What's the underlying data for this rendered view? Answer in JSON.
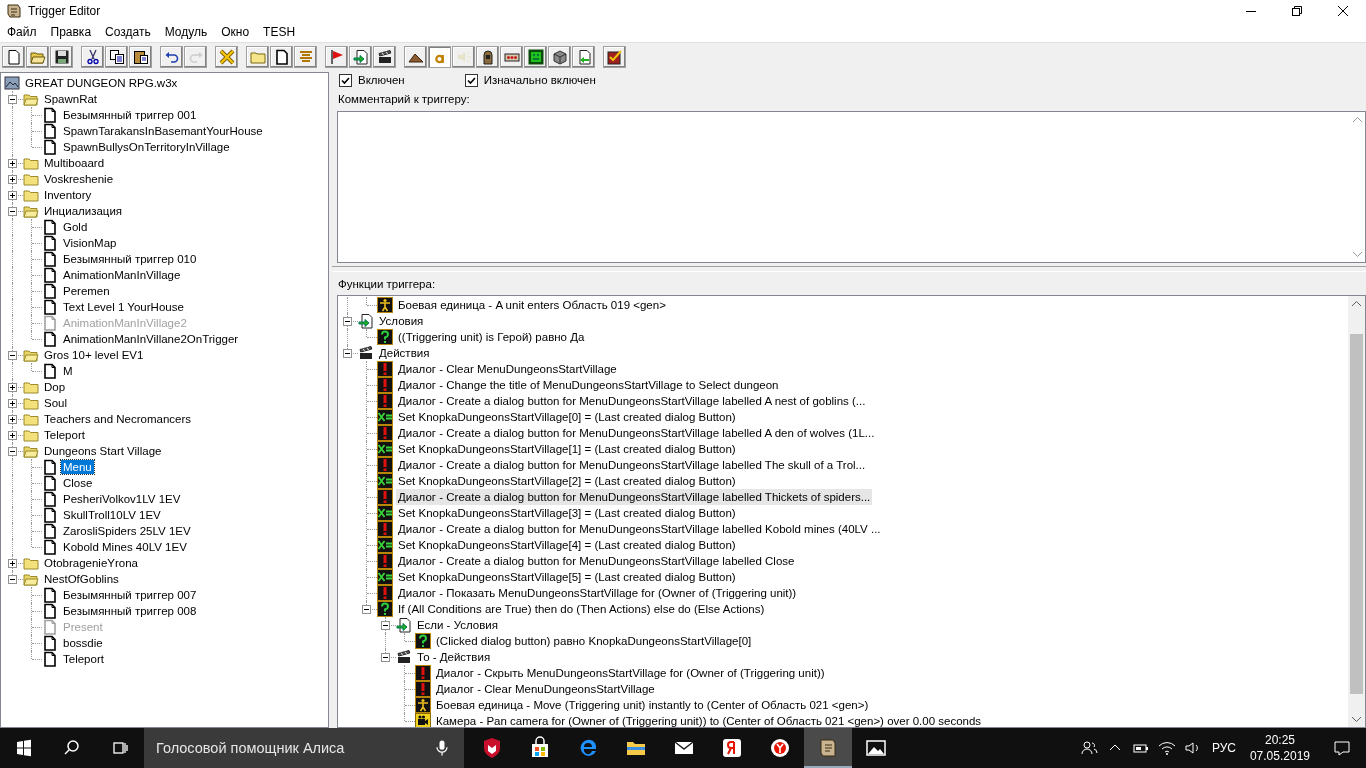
{
  "window": {
    "title": "Trigger Editor"
  },
  "menu": [
    "Файл",
    "Правка",
    "Создать",
    "Модуль",
    "Окно",
    "TESH"
  ],
  "toolbar": [
    [
      {
        "kind": "new",
        "pressed": false,
        "disabled": false
      },
      {
        "kind": "open",
        "pressed": false,
        "disabled": false
      },
      {
        "kind": "save",
        "pressed": false,
        "disabled": false
      }
    ],
    [
      {
        "kind": "cut",
        "pressed": false,
        "disabled": false
      },
      {
        "kind": "copy",
        "pressed": false,
        "disabled": false
      },
      {
        "kind": "paste",
        "pressed": false,
        "disabled": false
      }
    ],
    [
      {
        "kind": "undo",
        "pressed": false,
        "disabled": false
      },
      {
        "kind": "redo",
        "pressed": false,
        "disabled": true
      }
    ],
    [
      {
        "kind": "delete",
        "pressed": false,
        "disabled": false
      }
    ],
    [
      {
        "kind": "new-category",
        "pressed": false,
        "disabled": false
      },
      {
        "kind": "new-trigger",
        "pressed": false,
        "disabled": false
      },
      {
        "kind": "new-comment",
        "pressed": false,
        "disabled": false
      }
    ],
    [
      {
        "kind": "new-event",
        "pressed": false,
        "disabled": false
      },
      {
        "kind": "new-condition",
        "pressed": false,
        "disabled": false
      },
      {
        "kind": "new-action",
        "pressed": false,
        "disabled": false
      }
    ],
    [
      {
        "kind": "terrain",
        "pressed": false,
        "disabled": false
      },
      {
        "kind": "text",
        "pressed": true,
        "disabled": false
      },
      {
        "kind": "sound",
        "pressed": false,
        "disabled": true
      },
      {
        "kind": "unit",
        "pressed": false,
        "disabled": false
      },
      {
        "kind": "tiles",
        "pressed": false,
        "disabled": false
      },
      {
        "kind": "monster",
        "pressed": false,
        "disabled": false
      },
      {
        "kind": "box",
        "pressed": false,
        "disabled": false
      },
      {
        "kind": "import",
        "pressed": false,
        "disabled": false
      }
    ],
    [
      {
        "kind": "test",
        "pressed": false,
        "disabled": false
      }
    ]
  ],
  "tree": {
    "root": "GREAT DUNGEON RPG.w3x",
    "children": [
      {
        "kind": "folder",
        "label": "SpawnRat",
        "expanded": true,
        "selected": false,
        "children": [
          {
            "kind": "trigger",
            "label": "Безымянный триггер 001",
            "enabled": true,
            "selected": false
          },
          {
            "kind": "trigger",
            "label": "SpawnTarakansInBasemantYourHouse",
            "enabled": true,
            "selected": false
          },
          {
            "kind": "trigger",
            "label": "SpawnBullysOnTerritoryInVillage",
            "enabled": true,
            "selected": false
          }
        ]
      },
      {
        "kind": "folder",
        "label": "Multiboaard",
        "expanded": false,
        "selected": false
      },
      {
        "kind": "folder",
        "label": "Voskreshenie",
        "expanded": false,
        "selected": false
      },
      {
        "kind": "folder",
        "label": "Inventory",
        "expanded": false,
        "selected": false
      },
      {
        "kind": "folder",
        "label": "Инциализация",
        "expanded": true,
        "selected": false,
        "children": [
          {
            "kind": "trigger",
            "label": "Gold",
            "enabled": true,
            "selected": false
          },
          {
            "kind": "trigger",
            "label": "VisionMap",
            "enabled": true,
            "selected": false
          },
          {
            "kind": "trigger",
            "label": "Безымянный триггер 010",
            "enabled": true,
            "selected": false
          },
          {
            "kind": "trigger",
            "label": "AnimationManInVillage",
            "enabled": true,
            "selected": false
          },
          {
            "kind": "trigger",
            "label": "Peremen",
            "enabled": true,
            "selected": false
          },
          {
            "kind": "trigger",
            "label": "Text Level 1 YourHouse",
            "enabled": true,
            "selected": false
          },
          {
            "kind": "trigger",
            "label": "AnimationManInVillage2",
            "enabled": false,
            "selected": false
          },
          {
            "kind": "trigger",
            "label": "AnimationManInVillane2OnTrigger",
            "enabled": true,
            "selected": false
          }
        ]
      },
      {
        "kind": "folder",
        "label": "Gros 10+ level EV1",
        "expanded": true,
        "selected": false,
        "children": [
          {
            "kind": "trigger",
            "label": "M",
            "enabled": true,
            "selected": false
          }
        ]
      },
      {
        "kind": "folder",
        "label": "Dop",
        "expanded": false,
        "selected": false
      },
      {
        "kind": "folder",
        "label": "Soul",
        "expanded": false,
        "selected": false
      },
      {
        "kind": "folder",
        "label": "Teachers and Necromancers",
        "expanded": false,
        "selected": false
      },
      {
        "kind": "folder",
        "label": "Teleport",
        "expanded": false,
        "selected": false
      },
      {
        "kind": "folder",
        "label": "Dungeons Start Village",
        "expanded": true,
        "selected": false,
        "children": [
          {
            "kind": "trigger",
            "label": "Menu",
            "enabled": true,
            "selected": true
          },
          {
            "kind": "trigger",
            "label": "Close",
            "enabled": true,
            "selected": false
          },
          {
            "kind": "trigger",
            "label": "PesheriVolkov1LV 1EV",
            "enabled": true,
            "selected": false
          },
          {
            "kind": "trigger",
            "label": "SkullTroll10LV 1EV",
            "enabled": true,
            "selected": false
          },
          {
            "kind": "trigger",
            "label": "ZarosliSpiders 25LV 1EV",
            "enabled": true,
            "selected": false
          },
          {
            "kind": "trigger",
            "label": "Kobold Mines 40LV 1EV",
            "enabled": true,
            "selected": false
          }
        ]
      },
      {
        "kind": "folder",
        "label": "OtobragenieYrona",
        "expanded": false,
        "selected": false
      },
      {
        "kind": "folder",
        "label": "NestOfGoblins",
        "expanded": true,
        "selected": false,
        "children": [
          {
            "kind": "trigger",
            "label": "Безымянный триггер 007",
            "enabled": true,
            "selected": false
          },
          {
            "kind": "trigger",
            "label": "Безымянный триггер 008",
            "enabled": true,
            "selected": false
          },
          {
            "kind": "trigger",
            "label": "Present",
            "enabled": false,
            "selected": false
          },
          {
            "kind": "trigger",
            "label": "bossdie",
            "enabled": true,
            "selected": false
          },
          {
            "kind": "trigger",
            "label": "Teleport",
            "enabled": true,
            "selected": false
          }
        ]
      }
    ]
  },
  "trigger": {
    "enabled": {
      "label": "Включен",
      "checked": true
    },
    "initially_on": {
      "label": "Изначально включен",
      "checked": true
    },
    "comment_label": "Комментарий к триггеру:",
    "functions_label": "Функции триггера:",
    "events": [
      {
        "kind": "unit",
        "text": "Боевая единица - A unit enters Область 019 <gen>",
        "selected": false
      }
    ],
    "nodes": [
      {
        "kind": "conditions",
        "text": "Условия",
        "expanded": true,
        "selected": false,
        "children": [
          {
            "kind": "condition",
            "text": "((Triggering unit) is Герой) равно Да",
            "selected": false
          }
        ]
      },
      {
        "kind": "actions",
        "text": "Действия",
        "expanded": true,
        "selected": false,
        "children": [
          {
            "kind": "dialog",
            "text": "Диалог - Clear MenuDungeonsStartVillage",
            "selected": false
          },
          {
            "kind": "dialog",
            "text": "Диалог - Change the title of MenuDungeonsStartVillage to Select dungeon",
            "selected": false
          },
          {
            "kind": "dialog",
            "text": "Диалог - Create a dialog button for MenuDungeonsStartVillage labelled A nest of goblins (...",
            "selected": false
          },
          {
            "kind": "set",
            "text": "Set KnopkaDungeonsStartVillage[0] = (Last created dialog Button)",
            "selected": false
          },
          {
            "kind": "dialog",
            "text": "Диалог - Create a dialog button for MenuDungeonsStartVillage labelled A den of wolves (1L...",
            "selected": false
          },
          {
            "kind": "set",
            "text": "Set KnopkaDungeonsStartVillage[1] = (Last created dialog Button)",
            "selected": false
          },
          {
            "kind": "dialog",
            "text": "Диалог - Create a dialog button for MenuDungeonsStartVillage labelled The skull of a Trol...",
            "selected": false
          },
          {
            "kind": "set",
            "text": "Set KnopkaDungeonsStartVillage[2] = (Last created dialog Button)",
            "selected": false
          },
          {
            "kind": "dialog",
            "text": "Диалог - Create a dialog button for MenuDungeonsStartVillage labelled Thickets of spiders...",
            "selected": true
          },
          {
            "kind": "set",
            "text": "Set KnopkaDungeonsStartVillage[3] = (Last created dialog Button)",
            "selected": false
          },
          {
            "kind": "dialog",
            "text": "Диалог - Create a dialog button for MenuDungeonsStartVillage labelled Kobold mines (40LV ...",
            "selected": false
          },
          {
            "kind": "set",
            "text": "Set KnopkaDungeonsStartVillage[4] = (Last created dialog Button)",
            "selected": false
          },
          {
            "kind": "dialog",
            "text": "Диалог - Create a dialog button for MenuDungeonsStartVillage labelled Close",
            "selected": false
          },
          {
            "kind": "set",
            "text": "Set KnopkaDungeonsStartVillage[5] = (Last created dialog Button)",
            "selected": false
          },
          {
            "kind": "dialog",
            "text": "Диалог - Показать MenuDungeonsStartVillage for (Owner of (Triggering unit))",
            "selected": false
          },
          {
            "kind": "if",
            "text": "If (All Conditions are True) then do (Then Actions) else do (Else Actions)",
            "expanded": true,
            "selected": false,
            "children": [
              {
                "kind": "conditions",
                "text": "Если - Условия",
                "expanded": true,
                "selected": false,
                "children": [
                  {
                    "kind": "condition",
                    "text": "(Clicked dialog button) равно KnopkaDungeonsStartVillage[0]",
                    "selected": false
                  }
                ]
              },
              {
                "kind": "actions",
                "text": "То - Действия",
                "expanded": true,
                "selected": false,
                "children": [
                  {
                    "kind": "dialog",
                    "text": "Диалог - Скрыть MenuDungeonsStartVillage for (Owner of (Triggering unit))",
                    "selected": false
                  },
                  {
                    "kind": "dialog",
                    "text": "Диалог - Clear MenuDungeonsStartVillage",
                    "selected": false
                  },
                  {
                    "kind": "unit",
                    "text": "Боевая единица - Move (Triggering unit) instantly to (Center of Область 021 <gen>)",
                    "selected": false
                  },
                  {
                    "kind": "camera",
                    "text": "Камера - Pan camera for (Owner of (Triggering unit)) to (Center of Область 021 <gen>) over 0.00 seconds",
                    "selected": false
                  }
                ]
              }
            ]
          }
        ]
      }
    ]
  },
  "taskbar": {
    "search_placeholder": "Голосовой помощник Алиса",
    "apps": [
      {
        "kind": "shield",
        "active": false
      },
      {
        "kind": "store",
        "active": false
      },
      {
        "kind": "edge",
        "active": false
      },
      {
        "kind": "explorer",
        "active": false
      },
      {
        "kind": "mail",
        "active": false
      },
      {
        "kind": "yandex",
        "active": false
      },
      {
        "kind": "ybrowser",
        "active": false
      },
      {
        "kind": "editor",
        "active": true
      },
      {
        "kind": "photos",
        "active": false
      }
    ],
    "language": "РУС",
    "time": "20:25",
    "date": "07.05.2019"
  }
}
